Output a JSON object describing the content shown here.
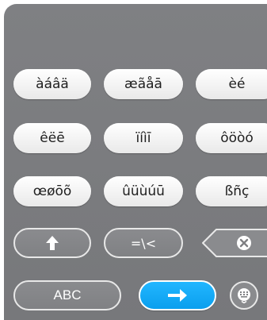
{
  "keyboard": {
    "accent_keys": [
      [
        "àáâä",
        "æãåā",
        "èé"
      ],
      [
        "êëē",
        "ïíìī",
        "ôöòó"
      ],
      [
        "œøōõ",
        "ûüùúū",
        "ßñç"
      ]
    ],
    "symbols_label": "=\\<",
    "abc_label": "ABC"
  },
  "icons": {
    "shift": "arrow-up-icon",
    "backspace": "backspace-icon",
    "enter": "arrow-right-icon",
    "hide_keyboard": "keyboard-icon"
  },
  "colors": {
    "panel": "#7f8083",
    "key": "#ffffff",
    "enter": "#16aaf7"
  }
}
